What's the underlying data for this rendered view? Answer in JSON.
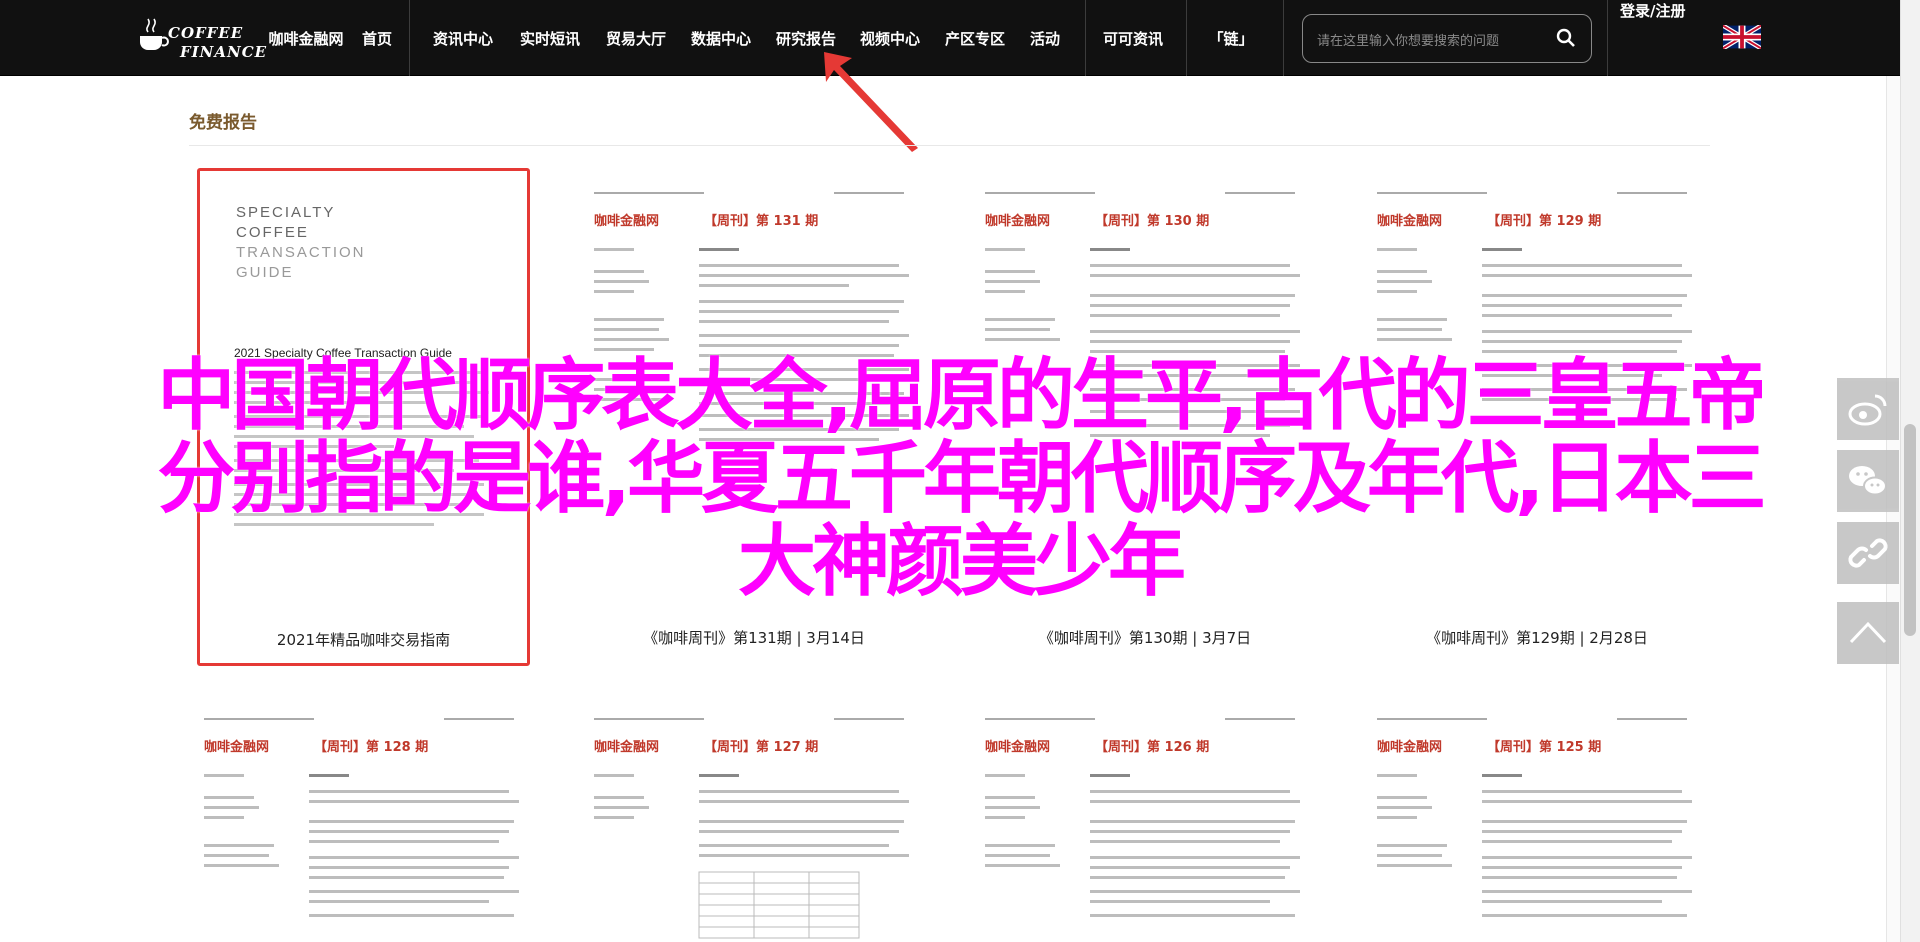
{
  "header": {
    "logo": {
      "line1": "COFFEE",
      "line2": "FINANCE"
    },
    "nav": [
      "咖啡金融网",
      "首页",
      "资讯中心",
      "实时短讯",
      "贸易大厅",
      "数据中心",
      "研究报告",
      "视频中心",
      "产区专区",
      "活动",
      "可可资讯",
      "「链」"
    ],
    "search": {
      "placeholder": "请在这里输入你想要搜索的问题"
    },
    "login": "登录/注册",
    "lang_icon": "uk-flag-icon"
  },
  "section": {
    "title": "免费报告"
  },
  "cover": {
    "lines": [
      "SPECIALTY",
      "COFFEE",
      "TRANSACTION",
      "GUIDE"
    ],
    "subtitle": "2021 Specialty Coffee Transaction Guide",
    "caption": "2021年精品咖啡交易指南"
  },
  "doc_brand": "咖啡金融网",
  "reports": [
    {
      "issue": "【周刊】第 131 期",
      "caption": "《咖啡周刊》第131期 | 3月14日"
    },
    {
      "issue": "【周刊】第 130 期",
      "caption": "《咖啡周刊》第130期 | 3月7日"
    },
    {
      "issue": "【周刊】第 129 期",
      "caption": "《咖啡周刊》第129期 | 2月28日"
    },
    {
      "issue": "【周刊】第 128 期",
      "caption": ""
    },
    {
      "issue": "【周刊】第 127 期",
      "caption": ""
    },
    {
      "issue": "【周刊】第 126 期",
      "caption": ""
    },
    {
      "issue": "【周刊】第 125 期",
      "caption": ""
    }
  ],
  "overlay": {
    "line1": "中国朝代顺序表大全,屈原的生平,古代的三皇五帝",
    "line2": "分别指的是谁,华夏五千年朝代顺序及年代,日本三",
    "line3": "大神颜美少年"
  },
  "share_icons": [
    "weibo-icon",
    "wechat-icon",
    "link-icon",
    "back-to-top-icon"
  ],
  "colors": {
    "nav_bg": "#111111",
    "brand_red": "#c0392b",
    "highlight_border": "#e53935",
    "overlay_text": "#ff00ff",
    "section_title": "#7a5a2e"
  }
}
